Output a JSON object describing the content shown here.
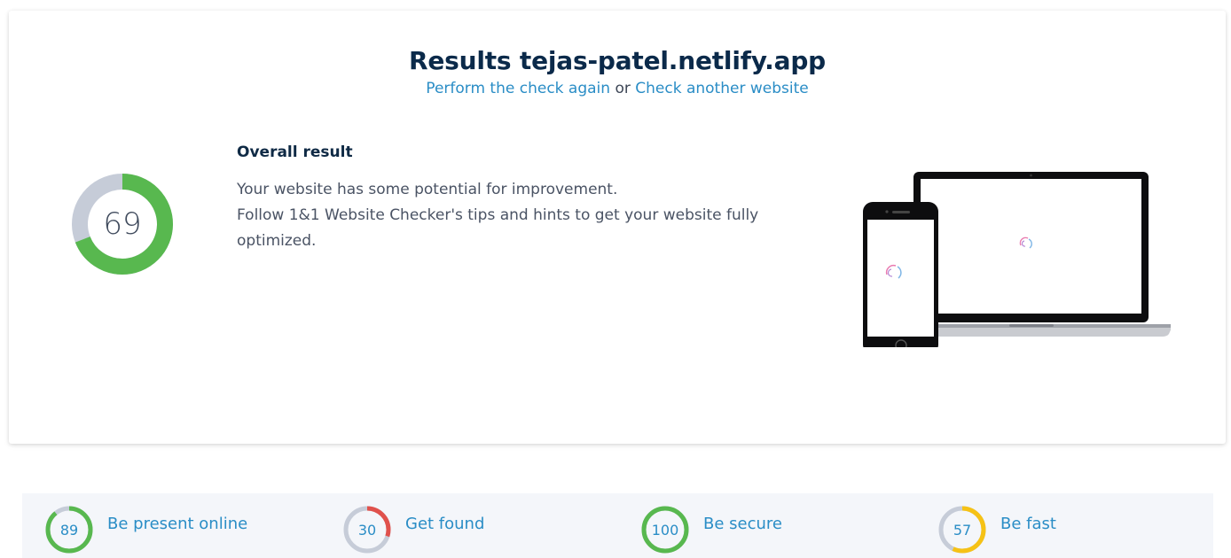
{
  "header": {
    "title": "Results tejas-patel.netlify.app",
    "check_again_link": "Perform the check again",
    "or_text": " or ",
    "check_another_link": "Check another website"
  },
  "overall": {
    "score": "69",
    "score_fraction": 0.69,
    "heading": "Overall result",
    "line1": "Your website has some potential for improvement.",
    "line2": "Follow 1&1 Website Checker's tips and hints to get your website fully optimized."
  },
  "categories": [
    {
      "label": "Be present online",
      "score": "89",
      "fraction": 0.89,
      "color": "#58b84f"
    },
    {
      "label": "Get found",
      "score": "30",
      "fraction": 0.3,
      "color": "#e0514c"
    },
    {
      "label": "Be secure",
      "score": "100",
      "fraction": 1.0,
      "color": "#58b84f"
    },
    {
      "label": "Be fast",
      "score": "57",
      "fraction": 0.57,
      "color": "#f6c215"
    }
  ],
  "colors": {
    "ring_track": "#c6ccd8",
    "good": "#58b84f",
    "link": "#2a8dc6",
    "title": "#0b2a4a"
  },
  "icons": [
    "smartphone-illustration",
    "laptop-illustration",
    "loading-spinner-icon"
  ]
}
